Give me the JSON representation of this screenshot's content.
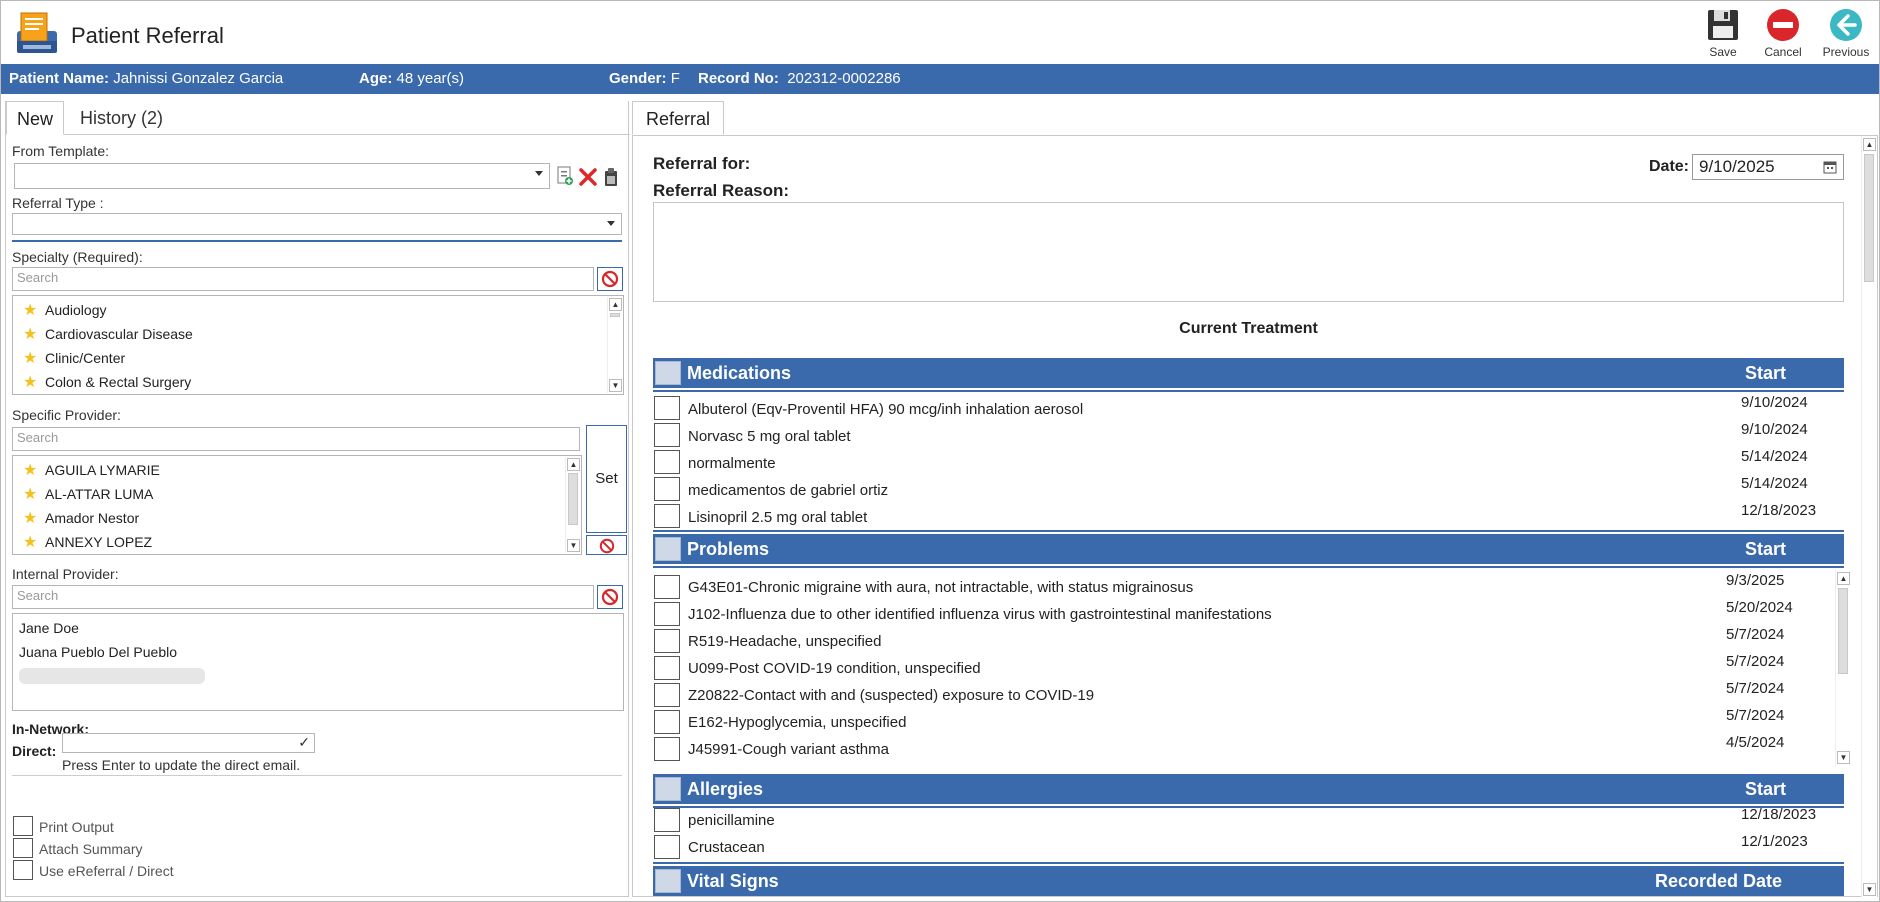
{
  "window": {
    "title": "Patient Referral",
    "toolbar": {
      "save": "Save",
      "cancel": "Cancel",
      "previous": "Previous"
    }
  },
  "patient": {
    "name_label": "Patient Name:",
    "name": "Jahnissi Gonzalez Garcia",
    "age_label": "Age:",
    "age": "48 year(s)",
    "gender_label": "Gender:",
    "gender": "F",
    "record_label": "Record No:",
    "record": "202312-0002286"
  },
  "left": {
    "tabs": {
      "new": "New",
      "history": "History (2)"
    },
    "from_template_label": "From Template:",
    "referral_type_label": "Referral Type :",
    "specialty_label": "Specialty (Required):",
    "specialty_search_placeholder": "Search",
    "specialties": [
      "Audiology",
      "Cardiovascular Disease",
      "Clinic/Center",
      "Colon & Rectal Surgery"
    ],
    "specific_provider_label": "Specific Provider:",
    "provider_search_placeholder": "Search",
    "providers": [
      "AGUILA LYMARIE",
      "AL-ATTAR LUMA",
      "Amador Nestor",
      "ANNEXY LOPEZ"
    ],
    "set_button": "Set",
    "internal_provider_label": "Internal Provider:",
    "internal_search_placeholder": "Search",
    "internal_providers": [
      "Jane Doe",
      "Juana Pueblo Del Pueblo"
    ],
    "in_network_label": "In-Network:",
    "direct_label": "Direct:",
    "direct_hint": "Press Enter to update the direct email.",
    "options": [
      "Print Output",
      "Attach Summary",
      "Use eReferral / Direct"
    ]
  },
  "right": {
    "tab": "Referral",
    "referral_for_label": "Referral for:",
    "referral_reason_label": "Referral Reason:",
    "date_label": "Date:",
    "date_value": "9/10/2025",
    "current_treatment": "Current Treatment",
    "medications": {
      "title": "Medications",
      "start_label": "Start",
      "rows": [
        {
          "text": "Albuterol (Eqv-Proventil HFA) 90 mcg/inh inhalation aerosol",
          "date": "9/10/2024"
        },
        {
          "text": "Norvasc 5 mg oral tablet",
          "date": "9/10/2024"
        },
        {
          "text": "normalmente",
          "date": "5/14/2024"
        },
        {
          "text": "medicamentos de gabriel ortiz",
          "date": "5/14/2024"
        },
        {
          "text": "Lisinopril 2.5 mg oral tablet",
          "date": "12/18/2023"
        }
      ]
    },
    "problems": {
      "title": "Problems",
      "start_label": "Start",
      "rows": [
        {
          "text": "G43E01-Chronic migraine with aura, not intractable, with status migrainosus",
          "date": "9/3/2025"
        },
        {
          "text": "J102-Influenza due to other identified influenza virus with gastrointestinal manifestations",
          "date": "5/20/2024"
        },
        {
          "text": "R519-Headache, unspecified",
          "date": "5/7/2024"
        },
        {
          "text": "U099-Post COVID-19 condition, unspecified",
          "date": "5/7/2024"
        },
        {
          "text": "Z20822-Contact with and (suspected) exposure to COVID-19",
          "date": "5/7/2024"
        },
        {
          "text": "E162-Hypoglycemia, unspecified",
          "date": "5/7/2024"
        },
        {
          "text": "J45991-Cough variant asthma",
          "date": "4/5/2024"
        }
      ]
    },
    "allergies": {
      "title": "Allergies",
      "start_label": "Start",
      "rows": [
        {
          "text": "penicillamine",
          "date": "12/18/2023"
        },
        {
          "text": "Crustacean",
          "date": "12/1/2023"
        }
      ]
    },
    "vitals": {
      "title": "Vital Signs",
      "date_label": "Recorded Date"
    }
  },
  "colors": {
    "accent": "#3a6aab",
    "star": "#f2c21b",
    "cancel_red": "#d8262a",
    "previous_teal": "#3bb8c4"
  }
}
